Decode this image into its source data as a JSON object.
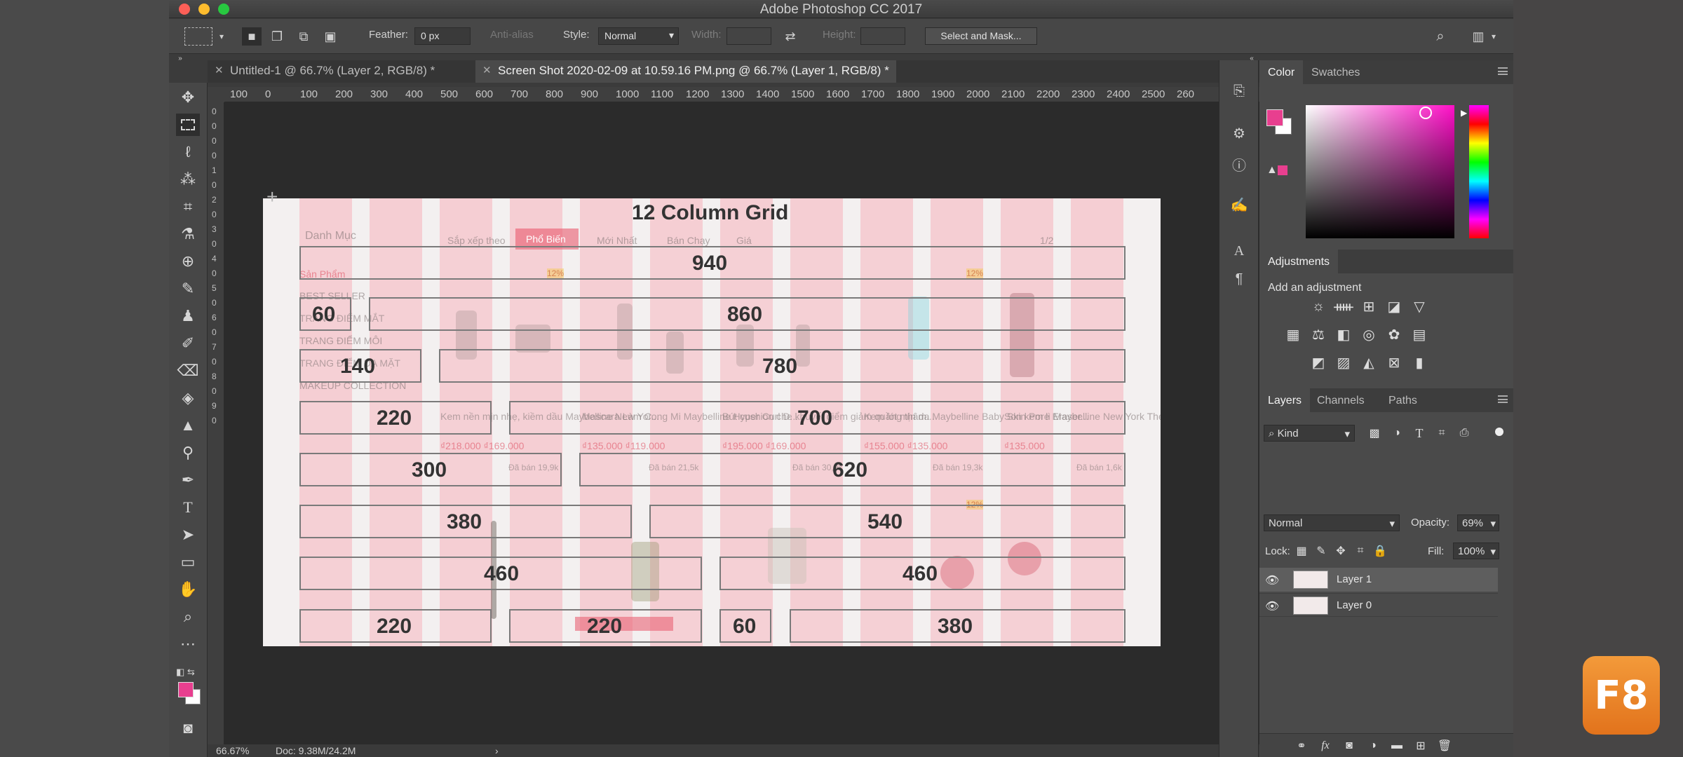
{
  "window": {
    "title": "Adobe Photoshop CC 2017"
  },
  "options": {
    "feather_label": "Feather:",
    "feather_value": "0 px",
    "antialias_label": "Anti-alias",
    "style_label": "Style:",
    "style_value": "Normal",
    "width_label": "Width:",
    "height_label": "Height:",
    "select_mask": "Select and Mask..."
  },
  "tabs": [
    {
      "label": "Untitled-1 @ 66.7% (Layer 2, RGB/8) *"
    },
    {
      "label": "Screen Shot 2020-02-09 at 10.59.16 PM.png @ 66.7% (Layer 1, RGB/8) *"
    }
  ],
  "ruler": {
    "h": [
      "100",
      "0",
      "100",
      "200",
      "300",
      "400",
      "500",
      "600",
      "700",
      "800",
      "900",
      "1000",
      "1100",
      "1200",
      "1300",
      "1400",
      "1500",
      "1600",
      "1700",
      "1800",
      "1900",
      "2000",
      "2100",
      "2200",
      "2300",
      "2400",
      "2500",
      "260"
    ],
    "v": [
      "0",
      "0",
      "0",
      "0",
      "1",
      "0",
      "2",
      "0",
      "3",
      "0",
      "4",
      "0",
      "5",
      "0",
      "6",
      "0",
      "7",
      "0",
      "8",
      "0",
      "9",
      "0"
    ]
  },
  "canvas": {
    "grid_title": "12 Column Grid",
    "labels": [
      "940",
      "60",
      "860",
      "140",
      "780",
      "220",
      "700",
      "300",
      "620",
      "380",
      "540",
      "460",
      "460",
      "220",
      "220",
      "60",
      "380"
    ],
    "ghost_text": {
      "sidebar_title": "Danh Mục",
      "sort_by": "Sắp xếp theo",
      "popular": "Phổ Biến",
      "newest": "Mới Nhất",
      "best_selling": "Bán Chạy",
      "price": "Giá",
      "page": "1/2",
      "cat_products": "Sản Phẩm",
      "cat_best": "BEST SELLER",
      "cat_eyes": "TRANG ĐIỂM MẮT",
      "cat_lips": "TRANG ĐIỂM MÔI",
      "cat_face": "TRANG ĐIỂM DA MẶT",
      "cat_makeup": "MAKEUP COLLECTION",
      "p1": "Kem nền mịn nhẹ, kiềm dầu Maybelline New Yor...",
      "p2": "Mascara Làm Cong Mi Maybelline Hyper Curl D...",
      "p3": "Bút cushion che khuyết điểm giảm quầng thâm...",
      "p4": "Kem lót mịn da Maybelline Baby Skin Pore Eraser...",
      "p5": "Son kem lì Maybelline New York The Color Jolt 5ml",
      "price1": "₫218.000 ₫169.000",
      "price2": "₫135.000 ₫119.000",
      "price3": "₫195.000 ₫169.000",
      "price4": "₫155.000 ₫135.000",
      "price5": "₫135.000",
      "sold1": "Đã bán 19,9k",
      "sold2": "Đã bán 21,5k",
      "sold3": "Đã bán 30,9k",
      "sold4": "Đã bán 19,3k",
      "sold5": "Đã bán 1,6k",
      "sale_badge": "12%"
    }
  },
  "status": {
    "zoom": "66.67%",
    "doc": "Doc: 9.38M/24.2M"
  },
  "panels": {
    "color_tabs": [
      "Color",
      "Swatches"
    ],
    "adjust_title": "Adjustments",
    "adjust_subtitle": "Add an adjustment",
    "layers_tabs": [
      "Layers",
      "Channels",
      "Paths"
    ],
    "kind_label": "Kind",
    "blend_mode": "Normal",
    "opacity_label": "Opacity:",
    "opacity_value": "69%",
    "lock_label": "Lock:",
    "fill_label": "Fill:",
    "fill_value": "100%",
    "layers": [
      {
        "name": "Layer 1",
        "selected": true
      },
      {
        "name": "Layer 0",
        "selected": false
      }
    ]
  },
  "badge": {
    "text": "F8"
  },
  "colors": {
    "foreground": "#e83f8f",
    "background": "#ffffff",
    "accent_pink": "#f7a0ac"
  }
}
